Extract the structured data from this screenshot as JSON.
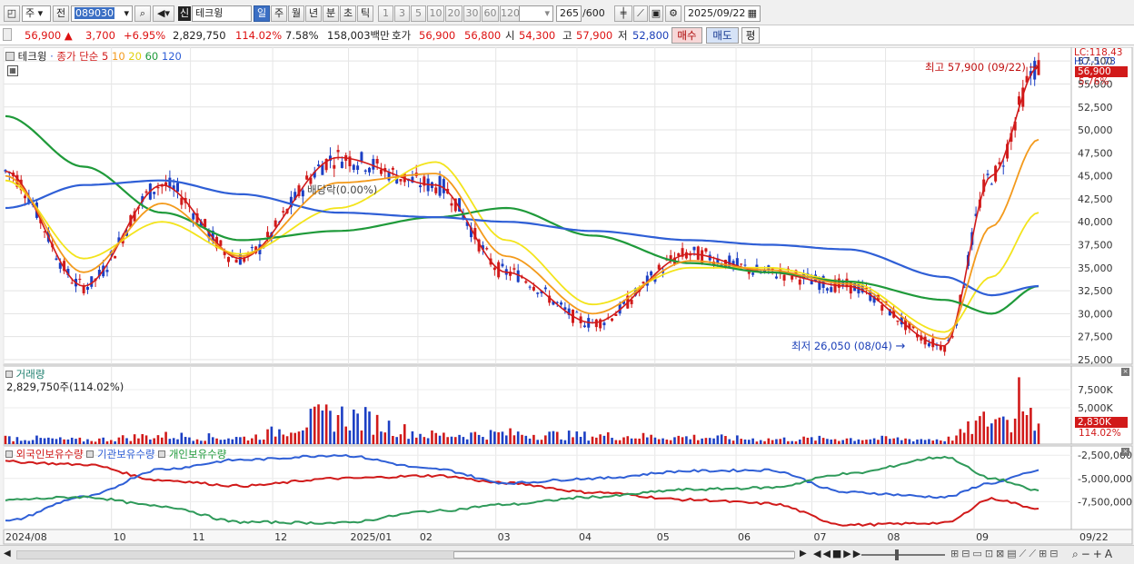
{
  "toolbar": {
    "market": "주",
    "prev_label": "전",
    "code": "089030",
    "new_badge": "신",
    "name": "테크윙",
    "periods": [
      "일",
      "주",
      "월",
      "년",
      "분",
      "초",
      "틱"
    ],
    "intervals": [
      "1",
      "3",
      "5",
      "10",
      "20",
      "30",
      "60",
      "120"
    ],
    "count": "265",
    "count_total": "/600",
    "date": "2025/09/22"
  },
  "quote": {
    "price": "56,900",
    "change": "3,700",
    "change_pct": "+6.95%",
    "volume": "2,829,750",
    "volume_ratio": "114.02%",
    "turnover": "7.58%",
    "amount": "158,003백만",
    "bid_label": "호가",
    "bid1": "56,900",
    "bid2": "56,800",
    "open_label": "시",
    "open": "54,300",
    "high_label": "고",
    "high": "57,900",
    "low_label": "저",
    "low": "52,800",
    "buy_label": "매수",
    "sell_label": "매도",
    "eval_label": "평"
  },
  "panel_labels": {
    "price_title": "테크윙",
    "ma_prefix": "종가 단순",
    "ma_periods": [
      "5",
      "10",
      "20",
      "60",
      "120"
    ],
    "lc": "LC:118.43",
    "hc": "HC:-1.73",
    "high_note": "최고 57,900 (09/22)",
    "low_note": "최저 26,050 (08/04)",
    "dividend_note": "배당락(0.00%)",
    "cur_price": "56,900",
    "cur_pct": "5.76%",
    "volume_title": "거래량",
    "volume_info": "2,829,750주(114.02%)",
    "cur_vol": "2,830K",
    "cur_vol_pct": "114.02%",
    "holders_foreign": "외국인보유수량",
    "holders_inst": "기관보유수량",
    "holders_retail": "개인보유수량"
  },
  "colors": {
    "up": "#d11a1a",
    "down": "#1c3fc4",
    "ma5": "#d11a1a",
    "ma10": "#f39a1c",
    "ma20": "#f3e41c",
    "ma60": "#1f9a3a",
    "ma120": "#2f5fd6",
    "sidebar_value": "#d11a1a"
  },
  "x_labels": [
    "2024/08",
    "10",
    "11",
    "12",
    "2025/01",
    "02",
    "03",
    "04",
    "05",
    "06",
    "07",
    "08",
    "08",
    "09",
    "09/22"
  ],
  "chart_data": [
    {
      "type": "line",
      "title": "테크윙",
      "y_ticks": [
        57500,
        55000,
        52500,
        50000,
        47500,
        45000,
        42500,
        40000,
        37500,
        35000,
        32500,
        30000,
        27500,
        25000
      ],
      "ylim": [
        24500,
        59000
      ],
      "series": [
        {
          "name": "5",
          "x": [
            "2024/08",
            "10",
            "11",
            "12",
            "2025/01",
            "02",
            "03",
            "04",
            "05",
            "06",
            "07",
            "08",
            "09",
            "09/22"
          ],
          "values": [
            45500,
            33000,
            44000,
            36000,
            47000,
            44000,
            34500,
            29000,
            36500,
            34500,
            33000,
            26500,
            45000,
            56900
          ]
        },
        {
          "name": "20",
          "x": [
            "2024/08",
            "10",
            "11",
            "12",
            "2025/01",
            "02",
            "03",
            "04",
            "05",
            "06",
            "07",
            "08",
            "09",
            "09/22"
          ],
          "values": [
            44500,
            36000,
            40000,
            36500,
            41500,
            46500,
            38000,
            31000,
            35000,
            35000,
            33500,
            28000,
            34000,
            41000
          ]
        },
        {
          "name": "60",
          "x": [
            "2024/08",
            "10",
            "11",
            "12",
            "2025/01",
            "02",
            "03",
            "04",
            "05",
            "06",
            "07",
            "08",
            "09",
            "09/22"
          ],
          "values": [
            51500,
            46000,
            41000,
            38000,
            39000,
            40500,
            41500,
            38500,
            35500,
            34500,
            33500,
            31500,
            30000,
            33000
          ]
        },
        {
          "name": "120",
          "x": [
            "2024/08",
            "10",
            "11",
            "12",
            "2025/01",
            "02",
            "03",
            "04",
            "05",
            "06",
            "07",
            "08",
            "09",
            "09/22"
          ],
          "values": [
            41500,
            44000,
            44500,
            43000,
            41000,
            40500,
            40000,
            39000,
            38000,
            37500,
            37000,
            34000,
            32000,
            33000
          ]
        }
      ]
    },
    {
      "type": "bar",
      "title": "거래량",
      "y_ticks": [
        "7,500K",
        "5,000K"
      ],
      "ylim": [
        0,
        10000000
      ],
      "categories": [
        "2024/08",
        "10",
        "11",
        "12",
        "2025/01",
        "02",
        "03",
        "04",
        "05",
        "06",
        "07",
        "08",
        "09",
        "09/22"
      ],
      "values": [
        900000,
        600000,
        1200000,
        900000,
        4000000,
        1300000,
        1500000,
        1200000,
        1000000,
        700000,
        800000,
        700000,
        3500000,
        2829750
      ]
    },
    {
      "type": "line",
      "y_ticks": [
        "-2,500,000",
        "-5,000,000",
        "-7,500,000"
      ],
      "ylim": [
        -10500000,
        -1500000
      ],
      "series": [
        {
          "name": "외국인보유수량",
          "x": [
            "2024/08",
            "10",
            "11",
            "12",
            "2025/01",
            "02",
            "03",
            "04",
            "05",
            "06",
            "07",
            "08",
            "09",
            "09/22"
          ],
          "values": [
            -3200000,
            -3500000,
            -5200000,
            -5800000,
            -5000000,
            -4700000,
            -5500000,
            -6500000,
            -7300000,
            -7700000,
            -10000000,
            -9800000,
            -7200000,
            -8200000
          ]
        },
        {
          "name": "기관보유수량",
          "x": [
            "2024/08",
            "10",
            "11",
            "12",
            "2025/01",
            "02",
            "03",
            "04",
            "05",
            "06",
            "07",
            "08",
            "09",
            "09/22"
          ],
          "values": [
            -9600000,
            -7000000,
            -4000000,
            -3000000,
            -2500000,
            -4000000,
            -5500000,
            -5000000,
            -4200000,
            -4100000,
            -6500000,
            -7000000,
            -5500000,
            -4200000
          ]
        },
        {
          "name": "개인보유수량",
          "x": [
            "2024/08",
            "10",
            "11",
            "12",
            "2025/01",
            "02",
            "03",
            "04",
            "05",
            "06",
            "07",
            "08",
            "09",
            "09/22"
          ],
          "values": [
            -7300000,
            -7000000,
            -8000000,
            -9700000,
            -9800000,
            -8500000,
            -7800000,
            -7000000,
            -6200000,
            -6000000,
            -4500000,
            -2700000,
            -5000000,
            -6300000
          ]
        }
      ]
    }
  ]
}
